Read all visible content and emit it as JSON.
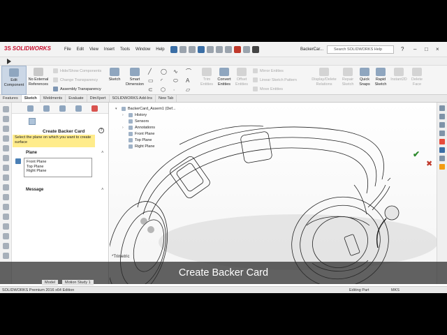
{
  "app": {
    "logo_text": "SOLIDWORKS",
    "menu": [
      "File",
      "Edit",
      "View",
      "Insert",
      "Tools",
      "Window",
      "Help"
    ],
    "document_title": "BackerCar...",
    "search_placeholder": "Search SOLIDWORKS Help"
  },
  "command_manager": {
    "edit_component": "Edit Component",
    "no_external_refs": "No External References",
    "hide_show": "Hide/Show Components",
    "change_transparency": "Change Transparency",
    "assembly_transparency": "Assembly Transparency",
    "sketch": "Sketch",
    "smart_dimension": "Smart Dimension",
    "trim_entities": "Trim Entities",
    "convert_entities": "Convert Entities",
    "offset_entities": "Offset Entities",
    "mirror_entities": "Mirror Entities",
    "linear_sketch_pattern": "Linear Sketch Pattern",
    "move_entities": "Move Entities",
    "display_delete_relations": "Display/Delete Relations",
    "repair_sketch": "Repair Sketch",
    "quick_snaps": "Quick Snaps",
    "rapid_sketch": "Rapid Sketch",
    "instant2d": "Instant2D",
    "delete_face": "Delete Face"
  },
  "tabs": [
    "Features",
    "Sketch",
    "Weldments",
    "Evaluate",
    "DimXpert",
    "SOLIDWORKS Add-Ins",
    "New Tab"
  ],
  "active_tab": "Sketch",
  "property_manager": {
    "title": "Create Backer Card",
    "message_section": "Message",
    "message_text": "Select the plane on which you want to create surface",
    "plane_section": "Plane",
    "planes": [
      "Front Plane",
      "Top Plane",
      "Right Plane"
    ]
  },
  "feature_tree": {
    "root": "BackerCard_Assem1 (Def...",
    "items": [
      "History",
      "Sensors",
      "Annotations",
      "Front Plane",
      "Top Plane",
      "Right Plane"
    ]
  },
  "view": {
    "orientation_label": "*Trimetric"
  },
  "model_tabs": [
    "Model",
    "Motion Study 1"
  ],
  "status_bar": {
    "edition": "SOLIDWORKS Premium 2016 x64 Edition",
    "state": "Editing Part",
    "units": "MKS"
  },
  "caption": "Create Backer Card",
  "colors": {
    "accent_blue": "#3a6ea5",
    "brand_red": "#c8102e",
    "message_yellow": "#ffec8b",
    "ok_green": "#2e8b2e"
  }
}
